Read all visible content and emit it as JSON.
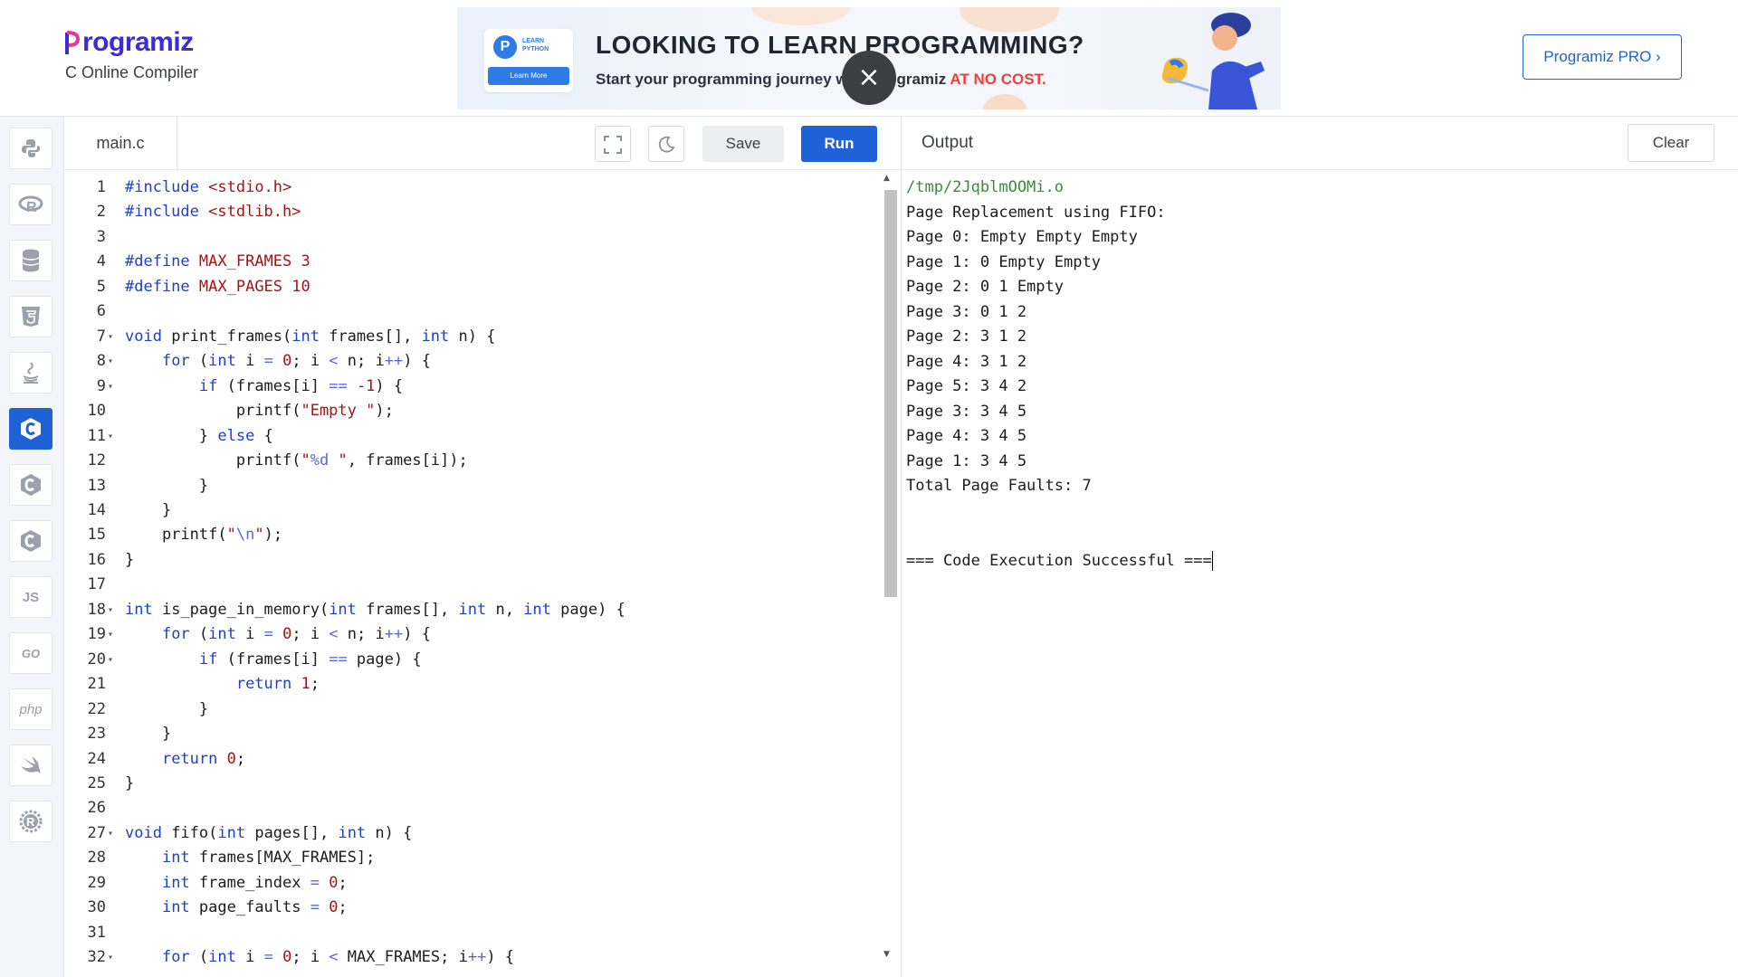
{
  "header": {
    "logo_text": "rogramiz",
    "logo_letter": "P",
    "subtitle": "C Online Compiler",
    "pro_button": "Programiz PRO ›"
  },
  "ad": {
    "badge_letter": "P",
    "badge_text": "LEARN PYTHON",
    "badge_button": "Learn More",
    "title": "LOOKING TO LEARN PROGRAMMING?",
    "subtitle_prefix": "Start your programming journey with Programiz ",
    "subtitle_highlight": "AT NO COST.",
    "close_icon": "×"
  },
  "sidebar": {
    "items": [
      {
        "name": "python",
        "glyph": "🐍"
      },
      {
        "name": "r",
        "glyph": "R"
      },
      {
        "name": "sql",
        "glyph": "≡"
      },
      {
        "name": "html",
        "glyph": "5"
      },
      {
        "name": "java",
        "glyph": "☕"
      },
      {
        "name": "c",
        "glyph": "C"
      },
      {
        "name": "cpp",
        "glyph": "C"
      },
      {
        "name": "csharp",
        "glyph": "C"
      },
      {
        "name": "js",
        "glyph": "JS"
      },
      {
        "name": "go",
        "glyph": "GO"
      },
      {
        "name": "php",
        "glyph": "php"
      },
      {
        "name": "swift",
        "glyph": "➶"
      },
      {
        "name": "rust",
        "glyph": "R"
      }
    ],
    "active": "c"
  },
  "editor": {
    "file_tab": "main.c",
    "fullscreen_icon": "⛶",
    "theme_icon": "☾",
    "save_label": "Save",
    "run_label": "Run"
  },
  "code": [
    {
      "n": "1",
      "fold": false,
      "html": "<span class='pp'>#include</span> <span class='str'>&lt;stdio.h&gt;</span>"
    },
    {
      "n": "2",
      "fold": false,
      "html": "<span class='pp'>#include</span> <span class='str'>&lt;stdlib.h&gt;</span>"
    },
    {
      "n": "3",
      "fold": false,
      "html": ""
    },
    {
      "n": "4",
      "fold": false,
      "html": "<span class='pp'>#define</span> <span class='str'>MAX_FRAMES 3</span>"
    },
    {
      "n": "5",
      "fold": false,
      "html": "<span class='pp'>#define</span> <span class='str'>MAX_PAGES 10</span>"
    },
    {
      "n": "6",
      "fold": false,
      "html": ""
    },
    {
      "n": "7",
      "fold": true,
      "html": "<span class='kw'>void</span> print_frames(<span class='kw'>int</span> frames[], <span class='kw'>int</span> n) {"
    },
    {
      "n": "8",
      "fold": true,
      "html": "    <span class='kw'>for</span> (<span class='kw'>int</span> i <span class='op'>=</span> <span class='num'>0</span>; i <span class='op'>&lt;</span> n; i<span class='op'>++</span>) {"
    },
    {
      "n": "9",
      "fold": true,
      "html": "        <span class='kw'>if</span> (frames[i] <span class='op'>==</span> <span class='num'>-1</span>) {"
    },
    {
      "n": "10",
      "fold": false,
      "html": "            printf(<span class='str'>\"Empty \"</span>);"
    },
    {
      "n": "11",
      "fold": true,
      "html": "        } <span class='kw'>else</span> {"
    },
    {
      "n": "12",
      "fold": false,
      "html": "            printf(<span class='str'>\"<span class='op'>%d</span> \"</span>, frames[i]);"
    },
    {
      "n": "13",
      "fold": false,
      "html": "        }"
    },
    {
      "n": "14",
      "fold": false,
      "html": "    }"
    },
    {
      "n": "15",
      "fold": false,
      "html": "    printf(<span class='str'>\"<span class='op'>\\n</span>\"</span>);"
    },
    {
      "n": "16",
      "fold": false,
      "html": "}"
    },
    {
      "n": "17",
      "fold": false,
      "html": ""
    },
    {
      "n": "18",
      "fold": true,
      "html": "<span class='kw'>int</span> is_page_in_memory(<span class='kw'>int</span> frames[], <span class='kw'>int</span> n, <span class='kw'>int</span> page) {"
    },
    {
      "n": "19",
      "fold": true,
      "html": "    <span class='kw'>for</span> (<span class='kw'>int</span> i <span class='op'>=</span> <span class='num'>0</span>; i <span class='op'>&lt;</span> n; i<span class='op'>++</span>) {"
    },
    {
      "n": "20",
      "fold": true,
      "html": "        <span class='kw'>if</span> (frames[i] <span class='op'>==</span> page) {"
    },
    {
      "n": "21",
      "fold": false,
      "html": "            <span class='kw'>return</span> <span class='num'>1</span>;"
    },
    {
      "n": "22",
      "fold": false,
      "html": "        }"
    },
    {
      "n": "23",
      "fold": false,
      "html": "    }"
    },
    {
      "n": "24",
      "fold": false,
      "html": "    <span class='kw'>return</span> <span class='num'>0</span>;"
    },
    {
      "n": "25",
      "fold": false,
      "html": "}"
    },
    {
      "n": "26",
      "fold": false,
      "html": ""
    },
    {
      "n": "27",
      "fold": true,
      "html": "<span class='kw'>void</span> fifo(<span class='kw'>int</span> pages[], <span class='kw'>int</span> n) {"
    },
    {
      "n": "28",
      "fold": false,
      "html": "    <span class='kw'>int</span> frames[MAX_FRAMES];"
    },
    {
      "n": "29",
      "fold": false,
      "html": "    <span class='kw'>int</span> frame_index <span class='op'>=</span> <span class='num'>0</span>;"
    },
    {
      "n": "30",
      "fold": false,
      "html": "    <span class='kw'>int</span> page_faults <span class='op'>=</span> <span class='num'>0</span>;"
    },
    {
      "n": "31",
      "fold": false,
      "html": ""
    },
    {
      "n": "32",
      "fold": true,
      "html": "    <span class='kw'>for</span> (<span class='kw'>int</span> i <span class='op'>=</span> <span class='num'>0</span>; i <span class='op'>&lt;</span> MAX_FRAMES; i<span class='op'>++</span>) {"
    }
  ],
  "output": {
    "title": "Output",
    "clear_label": "Clear",
    "path": "/tmp/2JqblmOOMi.o",
    "lines": [
      "Page Replacement using FIFO:",
      "Page 0: Empty Empty Empty",
      "Page 1: 0 Empty Empty",
      "Page 2: 0 1 Empty",
      "Page 3: 0 1 2",
      "Page 2: 3 1 2",
      "Page 4: 3 1 2",
      "Page 5: 3 4 2",
      "Page 3: 3 4 5",
      "Page 4: 3 4 5",
      "Page 1: 3 4 5",
      "Total Page Faults: 7",
      "",
      "",
      "=== Code Execution Successful ==="
    ]
  }
}
